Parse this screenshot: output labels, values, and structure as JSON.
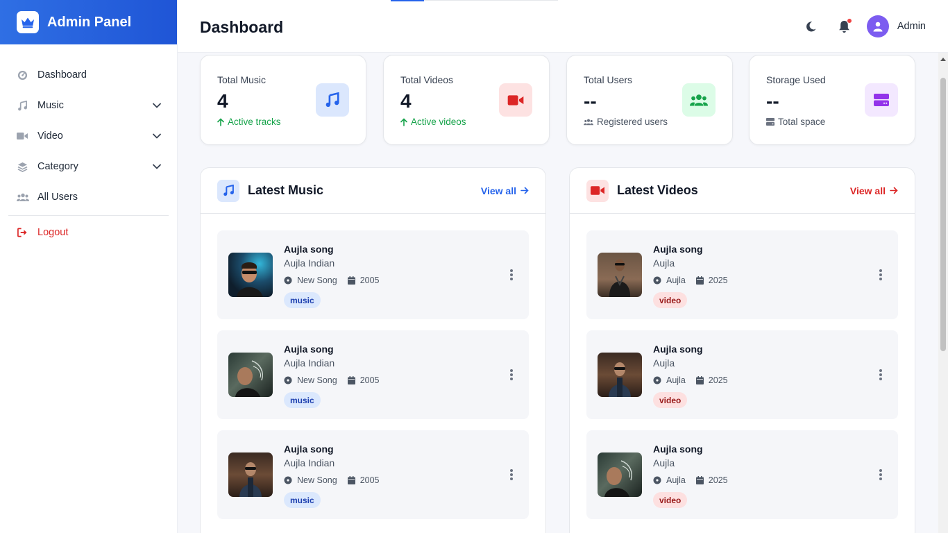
{
  "brand": {
    "title": "Admin Panel",
    "logo_icon": "crown-icon"
  },
  "sidebar": {
    "items": [
      {
        "label": "Dashboard",
        "icon": "gauge-icon",
        "expandable": false
      },
      {
        "label": "Music",
        "icon": "music-note-icon",
        "expandable": true
      },
      {
        "label": "Video",
        "icon": "video-camera-icon",
        "expandable": true
      },
      {
        "label": "Category",
        "icon": "layers-icon",
        "expandable": true
      },
      {
        "label": "All Users",
        "icon": "users-icon",
        "expandable": false
      }
    ],
    "logout": {
      "label": "Logout",
      "icon": "sign-out-icon",
      "color": "#dc2626"
    }
  },
  "header": {
    "title": "Dashboard",
    "user_name": "Admin"
  },
  "stats": [
    {
      "title": "Total Music",
      "value": "4",
      "sub": "Active tracks",
      "sub_icon": "arrow-up-icon",
      "icon": "music-note-icon",
      "color": "#2563eb",
      "bg": "#dbe7fd",
      "sub_color": "#16a34a"
    },
    {
      "title": "Total Videos",
      "value": "4",
      "sub": "Active videos",
      "sub_icon": "arrow-up-icon",
      "icon": "video-camera-icon",
      "color": "#dc2626",
      "bg": "#fde2e2",
      "sub_color": "#16a34a"
    },
    {
      "title": "Total Users",
      "value": "--",
      "sub": "Registered users",
      "sub_icon": "users-icon",
      "icon": "users-icon",
      "color": "#16a34a",
      "bg": "#dcfce7",
      "sub_color": "#4b5563"
    },
    {
      "title": "Storage Used",
      "value": "--",
      "sub": "Total space",
      "sub_icon": "hard-drive-icon",
      "icon": "hard-drive-icon",
      "color": "#9333ea",
      "bg": "#f3e8ff",
      "sub_color": "#4b5563"
    }
  ],
  "music_panel": {
    "title": "Latest Music",
    "view_all": "View all",
    "accent": "#2563eb",
    "items": [
      {
        "title": "Aujla song",
        "artist": "Aujla Indian",
        "album": "New Song",
        "year": "2005",
        "badge": "music"
      },
      {
        "title": "Aujla song",
        "artist": "Aujla Indian",
        "album": "New Song",
        "year": "2005",
        "badge": "music"
      },
      {
        "title": "Aujla song",
        "artist": "Aujla Indian",
        "album": "New Song",
        "year": "2005",
        "badge": "music"
      }
    ]
  },
  "video_panel": {
    "title": "Latest Videos",
    "view_all": "View all",
    "accent": "#dc2626",
    "items": [
      {
        "title": "Aujla song",
        "artist": "Aujla",
        "album": "Aujla",
        "year": "2025",
        "badge": "video"
      },
      {
        "title": "Aujla song",
        "artist": "Aujla",
        "album": "Aujla",
        "year": "2025",
        "badge": "video"
      },
      {
        "title": "Aujla song",
        "artist": "Aujla",
        "album": "Aujla",
        "year": "2025",
        "badge": "video"
      }
    ]
  }
}
